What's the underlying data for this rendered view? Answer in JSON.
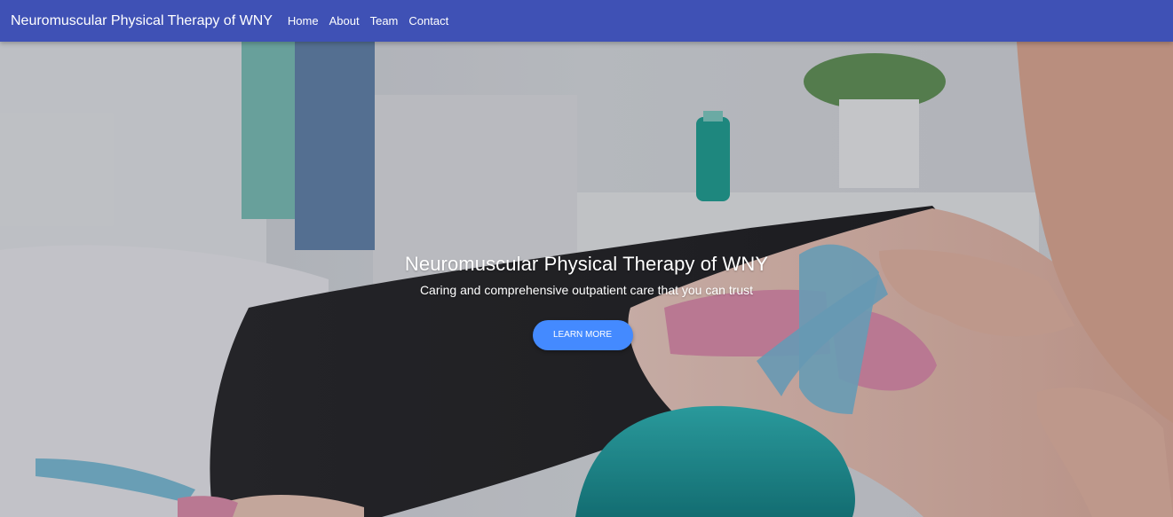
{
  "navbar": {
    "brand": "Neuromuscular Physical Therapy of WNY",
    "links": [
      "Home",
      "About",
      "Team",
      "Contact"
    ]
  },
  "hero": {
    "title": "Neuromuscular Physical Therapy of WNY",
    "subtitle": "Caring and comprehensive outpatient care that you can trust",
    "cta_label": "LEARN MORE",
    "image": "physical-therapy-kinesio-tape-photo"
  },
  "colors": {
    "navbar": "#3f51b5",
    "button": "#448aff",
    "text": "#ffffff"
  }
}
